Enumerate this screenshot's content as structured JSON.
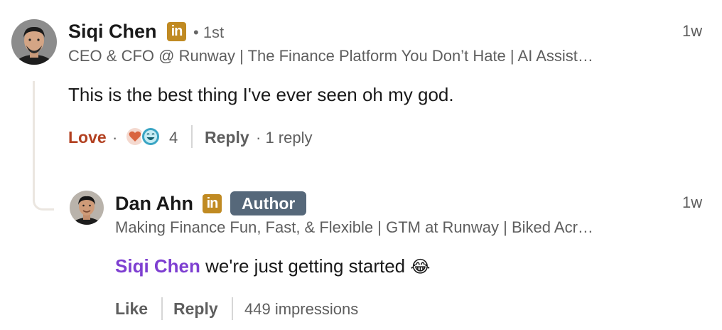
{
  "comment": {
    "author_name": "Siqi Chen",
    "linkedin_badge": "in",
    "degree": "• 1st",
    "headline": "CEO & CFO @ Runway | The Finance Platform You Don’t Hate | AI Assist…",
    "time": "1w",
    "text": "This is the best thing I've ever seen oh my god.",
    "reaction_label": "Love",
    "reaction_sep": "·",
    "reaction_count": "4",
    "reply_label": "Reply",
    "replies_count": "· 1 reply",
    "reaction_icons": [
      "heart-reaction-icon",
      "laugh-reaction-icon"
    ]
  },
  "reply": {
    "author_name": "Dan Ahn",
    "linkedin_badge": "in",
    "author_tag": "Author",
    "headline": "Making Finance Fun, Fast, & Flexible | GTM at Runway | Biked Acr…",
    "time": "1w",
    "mention": "Siqi Chen",
    "text": " we're just getting started",
    "emoji": "😂",
    "like_label": "Like",
    "reply_label": "Reply",
    "impressions": "449 impressions"
  },
  "colors": {
    "love": "#b24020",
    "mention": "#7e3fd1",
    "linkedin_badge": "#c08a22",
    "author_badge": "#56687a"
  }
}
